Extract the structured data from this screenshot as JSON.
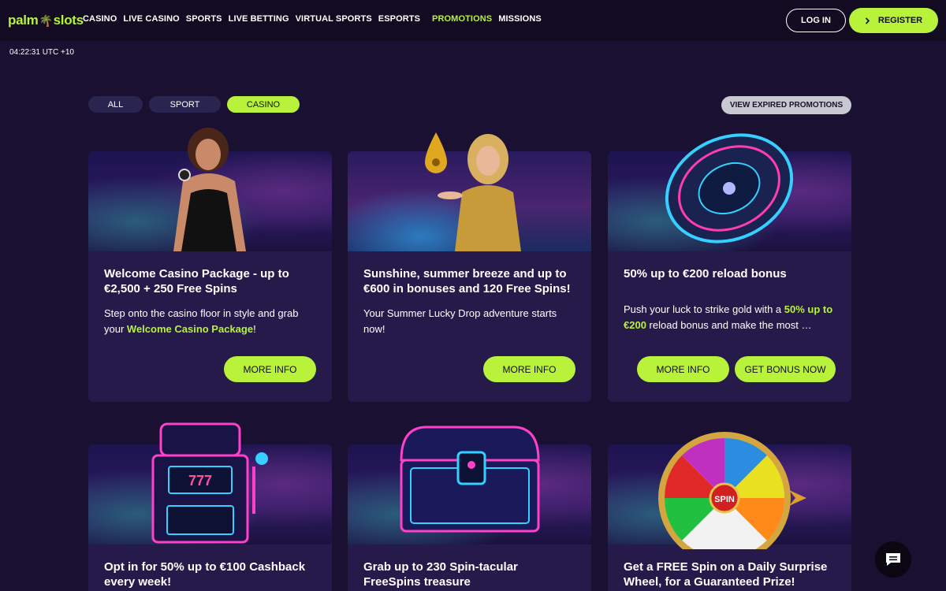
{
  "logo": {
    "left": "palm",
    "tree": "🌴",
    "right": "slots"
  },
  "nav": [
    "CASINO",
    "LIVE CASINO",
    "SPORTS",
    "LIVE BETTING",
    "VIRTUAL SPORTS",
    "ESPORTS",
    "PROMOTIONS",
    "MISSIONS"
  ],
  "nav_active": "PROMOTIONS",
  "auth": {
    "login": "LOG IN",
    "register": "REGISTER",
    "register_icon": "chevron-right-icon"
  },
  "clock": "04:22:31 UTC +10",
  "filters": {
    "all": "ALL",
    "sport": "SPORT",
    "casino": "CASINO",
    "active": "CASINO"
  },
  "expired": "VIEW EXPIRED PROMOTIONS",
  "cards": [
    {
      "title": "Welcome Casino Package - up to €2,500 + 250 Free Spins",
      "desc_before": "Step onto the casino floor in style and grab your ",
      "desc_highlight": "Welcome Casino Package",
      "desc_after": "!",
      "more": "MORE INFO"
    },
    {
      "title": "Sunshine, summer breeze and up to €600 in bonuses and 120 Free Spins!",
      "desc": "Your Summer Lucky Drop adventure starts now!",
      "more": "MORE INFO"
    },
    {
      "title": "50% up to €200 reload bonus",
      "desc_before": "Push your luck to strike gold with a ",
      "desc_highlight": "50% up to €200",
      "desc_after": " reload bonus and make the most …",
      "more": "MORE INFO",
      "get": "GET BONUS NOW"
    },
    {
      "title": "Opt in for 50% up to €100 Cashback every week!"
    },
    {
      "title": "Grab up to 230 Spin-tacular FreeSpins treasure"
    },
    {
      "title": "Get a FREE Spin on a Daily Surprise Wheel, for a Guaranteed Prize!"
    }
  ],
  "wheel_center": "SPIN",
  "colors": {
    "accent": "#b8f23a",
    "bg": "#1a1032",
    "card": "#251a4a"
  }
}
